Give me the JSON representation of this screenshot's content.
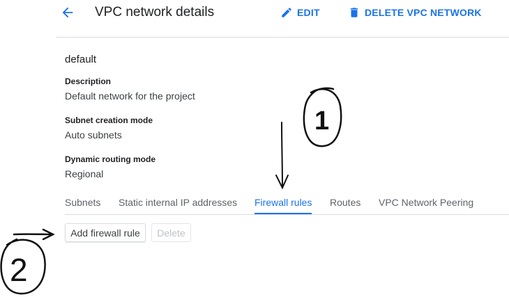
{
  "header": {
    "title": "VPC network details",
    "back_icon": "arrow-back-icon",
    "edit_label": "EDIT",
    "edit_icon": "pencil-icon",
    "delete_label": "DELETE VPC NETWORK",
    "delete_icon": "trash-icon",
    "accent_color": "#1a73e8"
  },
  "network": {
    "name": "default",
    "fields": [
      {
        "label": "Description",
        "value": "Default network for the project"
      },
      {
        "label": "Subnet creation mode",
        "value": "Auto subnets"
      },
      {
        "label": "Dynamic routing mode",
        "value": "Regional"
      }
    ]
  },
  "tabs": {
    "items": [
      {
        "label": "Subnets"
      },
      {
        "label": "Static internal IP addresses"
      },
      {
        "label": "Firewall rules"
      },
      {
        "label": "Routes"
      },
      {
        "label": "VPC Network Peering"
      }
    ],
    "active": "Firewall rules"
  },
  "toolbar": {
    "add_label": "Add firewall rule",
    "delete_label": "Delete",
    "delete_disabled": true
  },
  "annotations": {
    "step_one": "1",
    "step_two": "2"
  }
}
